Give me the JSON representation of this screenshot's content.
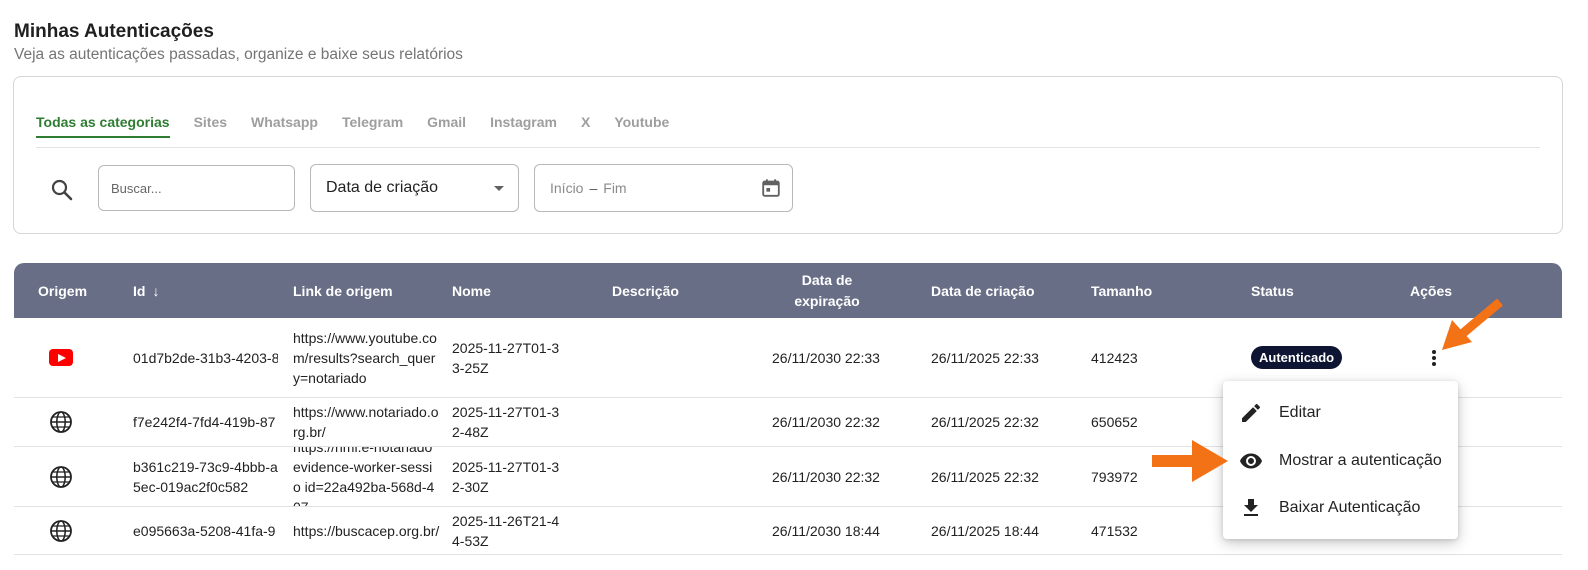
{
  "header": {
    "title": "Minhas Autenticações",
    "subtitle": "Veja as autenticações passadas, organize e baixe seus relatórios"
  },
  "tabs": [
    {
      "label": "Todas as categorias",
      "active": true
    },
    {
      "label": "Sites"
    },
    {
      "label": "Whatsapp"
    },
    {
      "label": "Telegram"
    },
    {
      "label": "Gmail"
    },
    {
      "label": "Instagram"
    },
    {
      "label": "X"
    },
    {
      "label": "Youtube"
    }
  ],
  "filters": {
    "search_placeholder": "Buscar...",
    "sort_select": "Data de criação",
    "date_start": "Início",
    "date_separator": "–",
    "date_end": "Fim"
  },
  "table": {
    "columns": {
      "origem": "Origem",
      "id": "Id",
      "sort_arrow": "↓",
      "link": "Link de origem",
      "nome": "Nome",
      "descricao": "Descrição",
      "expiracao": "Data de expiração",
      "criacao": "Data de criação",
      "tamanho": "Tamanho",
      "status": "Status",
      "acoes": "Ações"
    },
    "rows": [
      {
        "origin_icon": "youtube-icon",
        "id": "01d7b2de-31b3-4203-8",
        "link": "https://www.youtube.com/results?search_query=notariado",
        "nome": "2025-11-27T01-33-25Z",
        "descricao": "",
        "expiracao": "26/11/2030 22:33",
        "criacao": "26/11/2025 22:33",
        "tamanho": "412423",
        "status": "Autenticado"
      },
      {
        "origin_icon": "globe-icon",
        "id": "f7e242f4-7fd4-419b-87",
        "link": "https://www.notariado.org.br/",
        "nome": "2025-11-27T01-32-48Z",
        "descricao": "",
        "expiracao": "26/11/2030 22:32",
        "criacao": "26/11/2025 22:32",
        "tamanho": "650652",
        "status": ""
      },
      {
        "origin_icon": "globe-icon",
        "id": "b361c219-73c9-4bbb-a5ec-019ac2f0c582",
        "link": "https://hml.e-notariado evidence-worker-sessio id=22a492ba-568d-407",
        "nome": "2025-11-27T01-32-30Z",
        "descricao": "",
        "expiracao": "26/11/2030 22:32",
        "criacao": "26/11/2025 22:32",
        "tamanho": "793972",
        "status": ""
      },
      {
        "origin_icon": "globe-icon",
        "id": "e095663a-5208-41fa-9",
        "link": "https://buscacep.org.br/",
        "nome": "2025-11-26T21-44-53Z",
        "descricao": "",
        "expiracao": "26/11/2030 18:44",
        "criacao": "26/11/2025 18:44",
        "tamanho": "471532",
        "status": ""
      }
    ]
  },
  "menu": {
    "items": [
      {
        "label": "Editar",
        "icon": "pencil-icon"
      },
      {
        "label": "Mostrar a autenticação",
        "icon": "eye-icon"
      },
      {
        "label": "Baixar Autenticação",
        "icon": "download-icon"
      }
    ]
  },
  "colors": {
    "accent_green": "#2e7d32",
    "header_bg": "#686e86",
    "badge_bg": "#0d1533",
    "annotation_arrow": "#f47216"
  }
}
